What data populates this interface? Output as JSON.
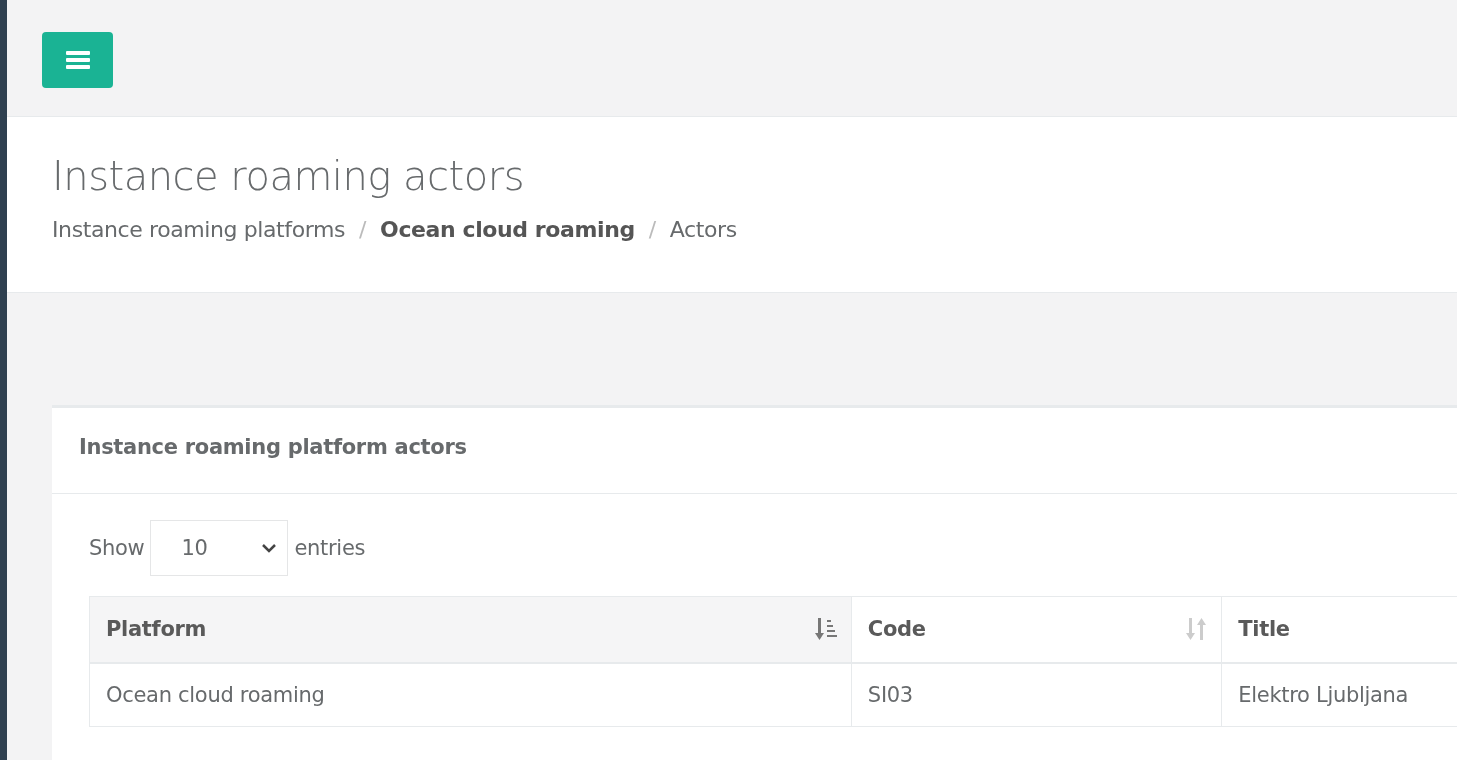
{
  "top_bar": {
    "menu_button": {
      "kind": "hamburger"
    }
  },
  "header": {
    "title": "Instance roaming actors",
    "breadcrumb": [
      {
        "label": "Instance roaming platforms",
        "bold": false
      },
      {
        "separator_before": "/",
        "label": "Ocean cloud roaming",
        "bold": true
      },
      {
        "separator_before": "/",
        "label": "Actors",
        "bold": false
      }
    ]
  },
  "panel": {
    "title": "Instance roaming platform actors",
    "length_menu": {
      "label_before": "Show",
      "value": "10",
      "label_after": "entries"
    },
    "table": {
      "columns": [
        {
          "label": "Platform",
          "sorted": true
        },
        {
          "label": "Code",
          "sorted": false
        },
        {
          "label": "Title"
        }
      ],
      "rows": [
        [
          "Ocean cloud roaming",
          "SI03",
          "Elektro Ljubljana"
        ]
      ]
    }
  }
}
